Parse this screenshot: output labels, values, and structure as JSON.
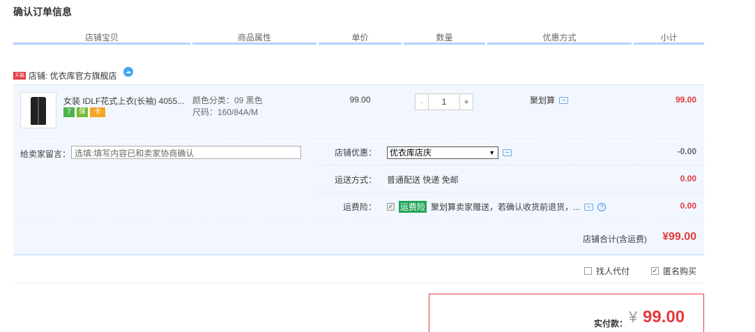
{
  "page": {
    "title": "确认订单信息"
  },
  "columns": {
    "shop": "店铺宝贝",
    "attr": "商品属性",
    "price": "单价",
    "qty": "数量",
    "discount": "优惠方式",
    "subtotal": "小计"
  },
  "shop": {
    "badge": "天猫",
    "name": "店铺: 优衣库官方旗舰店"
  },
  "item": {
    "name": "女装 IDLF花式上衣(长袖) 4055...",
    "badges": [
      "7",
      "保",
      "卡"
    ],
    "attr_color": "颜色分类：09 黑色",
    "attr_size": "尺码：160/84A/M",
    "price": "99.00",
    "qty_minus": "-",
    "quantity": "1",
    "qty_plus": "+",
    "discount": "聚划算",
    "subtotal": "99.00"
  },
  "memo": {
    "label": "给卖家留言：",
    "placeholder": "选填:填写内容已和卖家协商确认"
  },
  "shop_discount": {
    "label": "店铺优惠：",
    "selected": "优衣库店庆",
    "amount": "-0.00"
  },
  "shipping": {
    "label": "运送方式：",
    "value": "普通配送 快递 免邮",
    "amount": "0.00"
  },
  "insurance": {
    "label": "运费险：",
    "tag": "运费险",
    "text": "聚划算卖家赠送，若确认收货前退货，...",
    "amount": "0.00"
  },
  "shop_total": {
    "label": "店铺合计(含运费)",
    "amount": "¥99.00"
  },
  "options": {
    "proxy_pay": "找人代付",
    "anonymous": "匿名购买",
    "anonymous_checked": true,
    "proxy_pay_checked": false
  },
  "payment": {
    "label": "实付款：",
    "currency": "¥",
    "amount": "99.00"
  },
  "colors": {
    "accent": "#e4393c",
    "header_line": "#b2d1ff",
    "row_bg": "#f2f7ff"
  }
}
